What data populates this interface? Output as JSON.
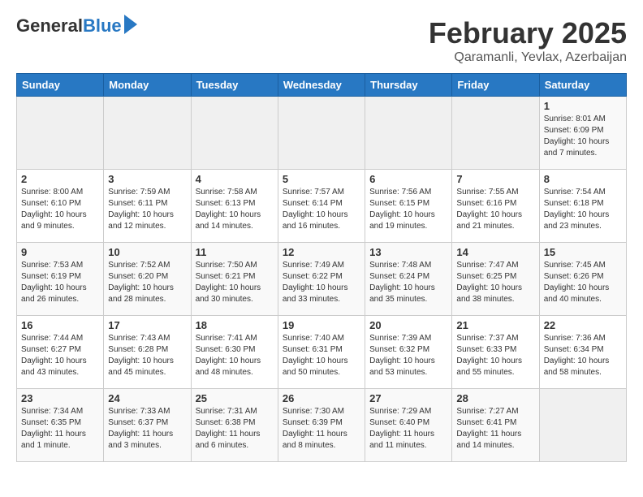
{
  "logo": {
    "general": "General",
    "blue": "Blue"
  },
  "header": {
    "month": "February 2025",
    "location": "Qaramanli, Yevlax, Azerbaijan"
  },
  "weekdays": [
    "Sunday",
    "Monday",
    "Tuesday",
    "Wednesday",
    "Thursday",
    "Friday",
    "Saturday"
  ],
  "weeks": [
    [
      {
        "day": "",
        "info": ""
      },
      {
        "day": "",
        "info": ""
      },
      {
        "day": "",
        "info": ""
      },
      {
        "day": "",
        "info": ""
      },
      {
        "day": "",
        "info": ""
      },
      {
        "day": "",
        "info": ""
      },
      {
        "day": "1",
        "info": "Sunrise: 8:01 AM\nSunset: 6:09 PM\nDaylight: 10 hours and 7 minutes."
      }
    ],
    [
      {
        "day": "2",
        "info": "Sunrise: 8:00 AM\nSunset: 6:10 PM\nDaylight: 10 hours and 9 minutes."
      },
      {
        "day": "3",
        "info": "Sunrise: 7:59 AM\nSunset: 6:11 PM\nDaylight: 10 hours and 12 minutes."
      },
      {
        "day": "4",
        "info": "Sunrise: 7:58 AM\nSunset: 6:13 PM\nDaylight: 10 hours and 14 minutes."
      },
      {
        "day": "5",
        "info": "Sunrise: 7:57 AM\nSunset: 6:14 PM\nDaylight: 10 hours and 16 minutes."
      },
      {
        "day": "6",
        "info": "Sunrise: 7:56 AM\nSunset: 6:15 PM\nDaylight: 10 hours and 19 minutes."
      },
      {
        "day": "7",
        "info": "Sunrise: 7:55 AM\nSunset: 6:16 PM\nDaylight: 10 hours and 21 minutes."
      },
      {
        "day": "8",
        "info": "Sunrise: 7:54 AM\nSunset: 6:18 PM\nDaylight: 10 hours and 23 minutes."
      }
    ],
    [
      {
        "day": "9",
        "info": "Sunrise: 7:53 AM\nSunset: 6:19 PM\nDaylight: 10 hours and 26 minutes."
      },
      {
        "day": "10",
        "info": "Sunrise: 7:52 AM\nSunset: 6:20 PM\nDaylight: 10 hours and 28 minutes."
      },
      {
        "day": "11",
        "info": "Sunrise: 7:50 AM\nSunset: 6:21 PM\nDaylight: 10 hours and 30 minutes."
      },
      {
        "day": "12",
        "info": "Sunrise: 7:49 AM\nSunset: 6:22 PM\nDaylight: 10 hours and 33 minutes."
      },
      {
        "day": "13",
        "info": "Sunrise: 7:48 AM\nSunset: 6:24 PM\nDaylight: 10 hours and 35 minutes."
      },
      {
        "day": "14",
        "info": "Sunrise: 7:47 AM\nSunset: 6:25 PM\nDaylight: 10 hours and 38 minutes."
      },
      {
        "day": "15",
        "info": "Sunrise: 7:45 AM\nSunset: 6:26 PM\nDaylight: 10 hours and 40 minutes."
      }
    ],
    [
      {
        "day": "16",
        "info": "Sunrise: 7:44 AM\nSunset: 6:27 PM\nDaylight: 10 hours and 43 minutes."
      },
      {
        "day": "17",
        "info": "Sunrise: 7:43 AM\nSunset: 6:28 PM\nDaylight: 10 hours and 45 minutes."
      },
      {
        "day": "18",
        "info": "Sunrise: 7:41 AM\nSunset: 6:30 PM\nDaylight: 10 hours and 48 minutes."
      },
      {
        "day": "19",
        "info": "Sunrise: 7:40 AM\nSunset: 6:31 PM\nDaylight: 10 hours and 50 minutes."
      },
      {
        "day": "20",
        "info": "Sunrise: 7:39 AM\nSunset: 6:32 PM\nDaylight: 10 hours and 53 minutes."
      },
      {
        "day": "21",
        "info": "Sunrise: 7:37 AM\nSunset: 6:33 PM\nDaylight: 10 hours and 55 minutes."
      },
      {
        "day": "22",
        "info": "Sunrise: 7:36 AM\nSunset: 6:34 PM\nDaylight: 10 hours and 58 minutes."
      }
    ],
    [
      {
        "day": "23",
        "info": "Sunrise: 7:34 AM\nSunset: 6:35 PM\nDaylight: 11 hours and 1 minute."
      },
      {
        "day": "24",
        "info": "Sunrise: 7:33 AM\nSunset: 6:37 PM\nDaylight: 11 hours and 3 minutes."
      },
      {
        "day": "25",
        "info": "Sunrise: 7:31 AM\nSunset: 6:38 PM\nDaylight: 11 hours and 6 minutes."
      },
      {
        "day": "26",
        "info": "Sunrise: 7:30 AM\nSunset: 6:39 PM\nDaylight: 11 hours and 8 minutes."
      },
      {
        "day": "27",
        "info": "Sunrise: 7:29 AM\nSunset: 6:40 PM\nDaylight: 11 hours and 11 minutes."
      },
      {
        "day": "28",
        "info": "Sunrise: 7:27 AM\nSunset: 6:41 PM\nDaylight: 11 hours and 14 minutes."
      },
      {
        "day": "",
        "info": ""
      }
    ]
  ]
}
